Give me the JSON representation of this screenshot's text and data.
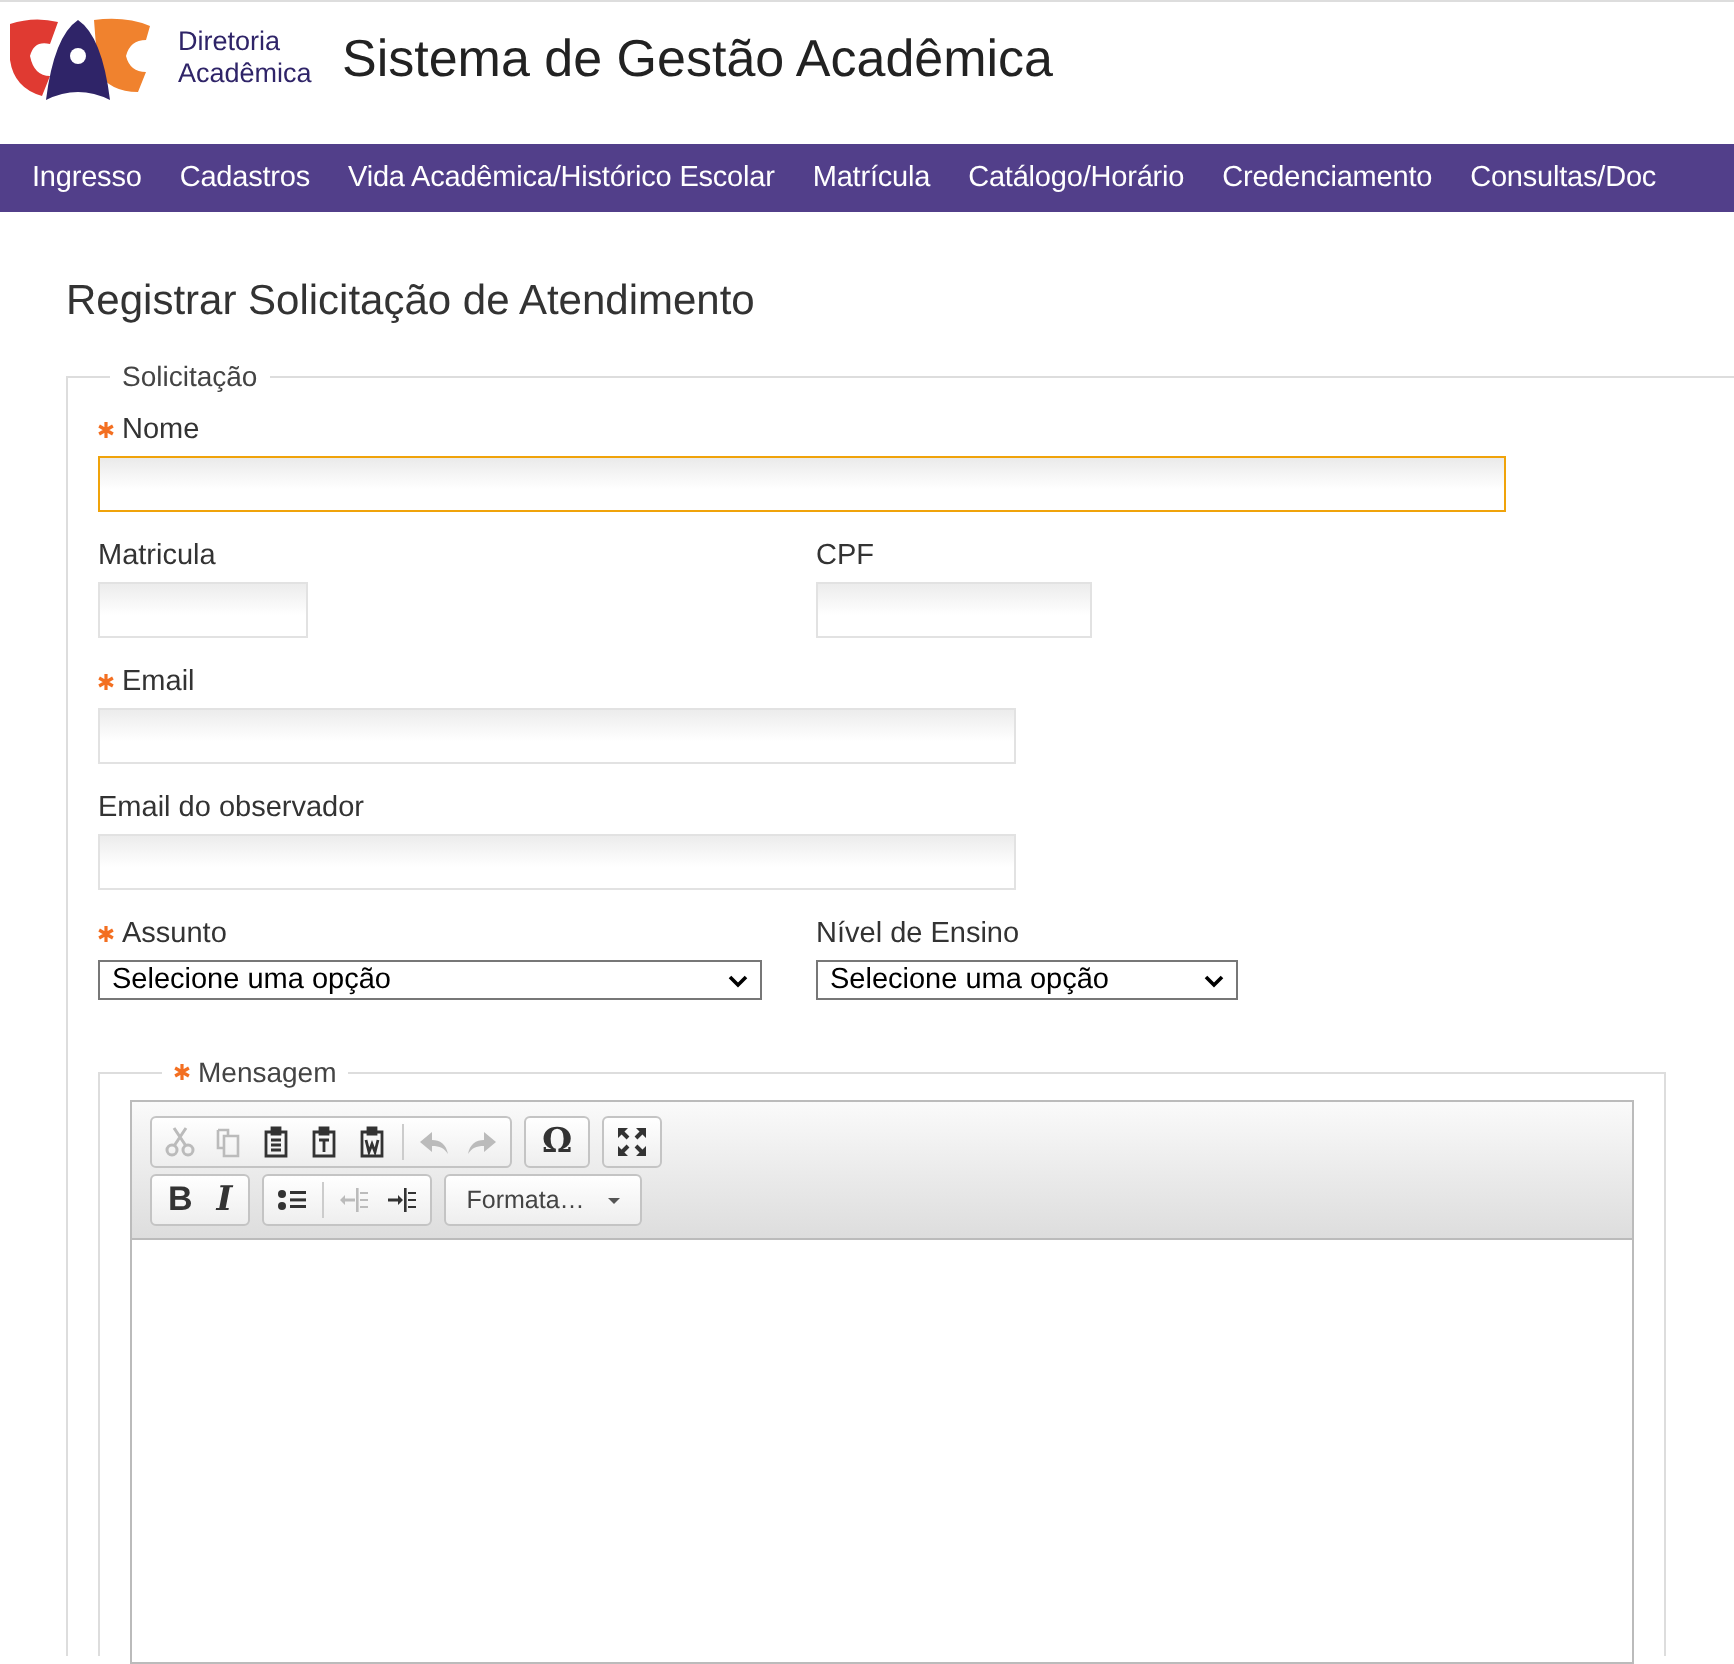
{
  "header": {
    "org": "Diretoria Acadêmica",
    "title": "Sistema de Gestão Acadêmica"
  },
  "nav": [
    "Ingresso",
    "Cadastros",
    "Vida Acadêmica/Histórico Escolar",
    "Matrícula",
    "Catálogo/Horário",
    "Credenciamento",
    "Consultas/Doc"
  ],
  "page_title": "Registrar Solicitação de Atendimento",
  "form": {
    "legend": "Solicitação",
    "rows": [
      [
        {
          "label": "Nome",
          "required": true,
          "focused": true,
          "kind": "text"
        }
      ],
      [
        {
          "label": "Matricula",
          "required": false,
          "focused": false,
          "kind": "text"
        },
        {
          "label": "CPF",
          "required": false,
          "focused": false,
          "kind": "text"
        }
      ],
      [
        {
          "label": "Email",
          "required": true,
          "focused": false,
          "kind": "text"
        }
      ],
      [
        {
          "label": "Email do observador",
          "required": false,
          "focused": false,
          "kind": "text"
        }
      ],
      [
        {
          "label": "Assunto",
          "required": true,
          "kind": "select",
          "value": "Selecione uma opção"
        },
        {
          "label": "Nível de Ensino",
          "required": false,
          "kind": "select",
          "value": "Selecione uma opção"
        }
      ]
    ]
  },
  "message": {
    "legend": "Mensagem",
    "required": true,
    "toolbar": [
      [
        [
          {
            "kind": "cut",
            "disabled": true
          },
          {
            "kind": "copy",
            "disabled": true
          },
          {
            "kind": "paste",
            "disabled": false
          },
          {
            "kind": "paste-text",
            "disabled": false
          },
          {
            "kind": "paste-word",
            "disabled": false
          },
          {
            "kind": "sep"
          },
          {
            "kind": "undo",
            "disabled": true
          },
          {
            "kind": "redo",
            "disabled": true
          }
        ],
        [
          {
            "kind": "char",
            "text": "Ω",
            "disabled": false
          }
        ],
        [
          {
            "kind": "maximize",
            "disabled": false
          }
        ]
      ],
      [
        [
          {
            "kind": "bold",
            "text": "B",
            "disabled": false
          },
          {
            "kind": "italic",
            "text": "I",
            "disabled": false
          }
        ],
        [
          {
            "kind": "bullets",
            "disabled": false
          },
          {
            "kind": "sep"
          },
          {
            "kind": "outdent",
            "disabled": true
          },
          {
            "kind": "indent",
            "disabled": false
          }
        ],
        [
          {
            "kind": "format",
            "text": "Formata…",
            "disabled": false
          }
        ]
      ]
    ]
  }
}
